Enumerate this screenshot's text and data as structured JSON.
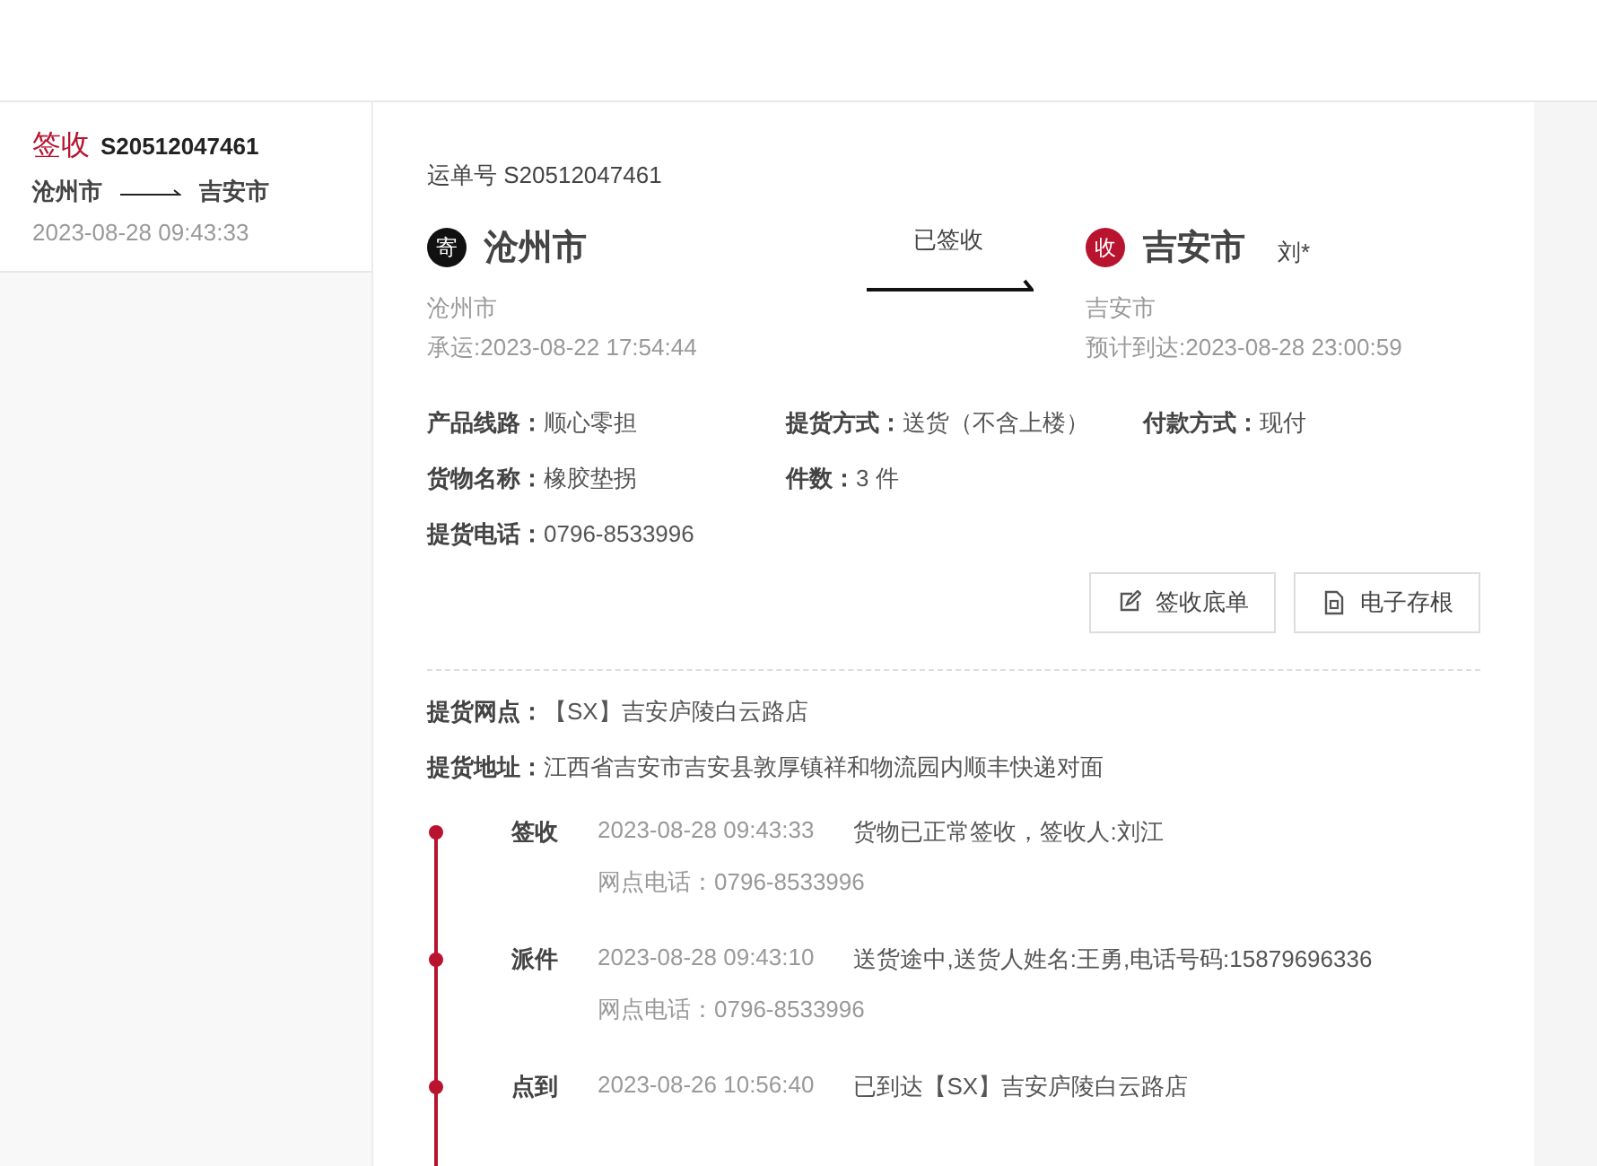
{
  "sidebar": {
    "items": [
      {
        "status": "签收",
        "waybill": "S20512047461",
        "from": "沧州市",
        "to": "吉安市",
        "time": "2023-08-28 09:43:33",
        "selected": true
      }
    ]
  },
  "detail": {
    "waybill_label": "运单号 S20512047461",
    "sender": {
      "badge": "寄",
      "city": "沧州市",
      "sub": "沧州市",
      "time": "承运:2023-08-22 17:54:44"
    },
    "status": "已签收",
    "receiver": {
      "badge": "收",
      "city": "吉安市",
      "name": "刘*",
      "sub": "吉安市",
      "time": "预计到达:2023-08-28 23:00:59"
    },
    "field_rows": [
      [
        {
          "label": "产品线路：",
          "value": "顺心零担"
        },
        {
          "label": "提货方式：",
          "value": "送货（不含上楼）"
        },
        {
          "label": "付款方式：",
          "value": "现付"
        }
      ],
      [
        {
          "label": "货物名称：",
          "value": "橡胶垫拐"
        },
        {
          "label": "件数：",
          "value": "3 件"
        }
      ],
      [
        {
          "label": "提货电话：",
          "value": "0796-8533996"
        }
      ]
    ],
    "buttons": [
      {
        "label": "签收底单",
        "kind": "edit"
      },
      {
        "label": "电子存根",
        "kind": "doc"
      }
    ],
    "pickup": [
      {
        "label": "提货网点：",
        "value": "【SX】吉安庐陵白云路店"
      },
      {
        "label": "提货地址：",
        "value": "江西省吉安市吉安县敦厚镇祥和物流园内顺丰快递对面"
      }
    ],
    "timeline": [
      {
        "event": "签收",
        "time": "2023-08-28 09:43:33",
        "desc": "货物已正常签收，签收人:刘江",
        "phone": "网点电话：0796-8533996"
      },
      {
        "event": "派件",
        "time": "2023-08-28 09:43:10",
        "desc": "送货途中,送货人姓名:王勇,电话号码:15879696336",
        "phone": "网点电话：0796-8533996"
      },
      {
        "event": "点到",
        "time": "2023-08-26 10:56:40",
        "desc": "已到达【SX】吉安庐陵白云路店"
      }
    ]
  }
}
